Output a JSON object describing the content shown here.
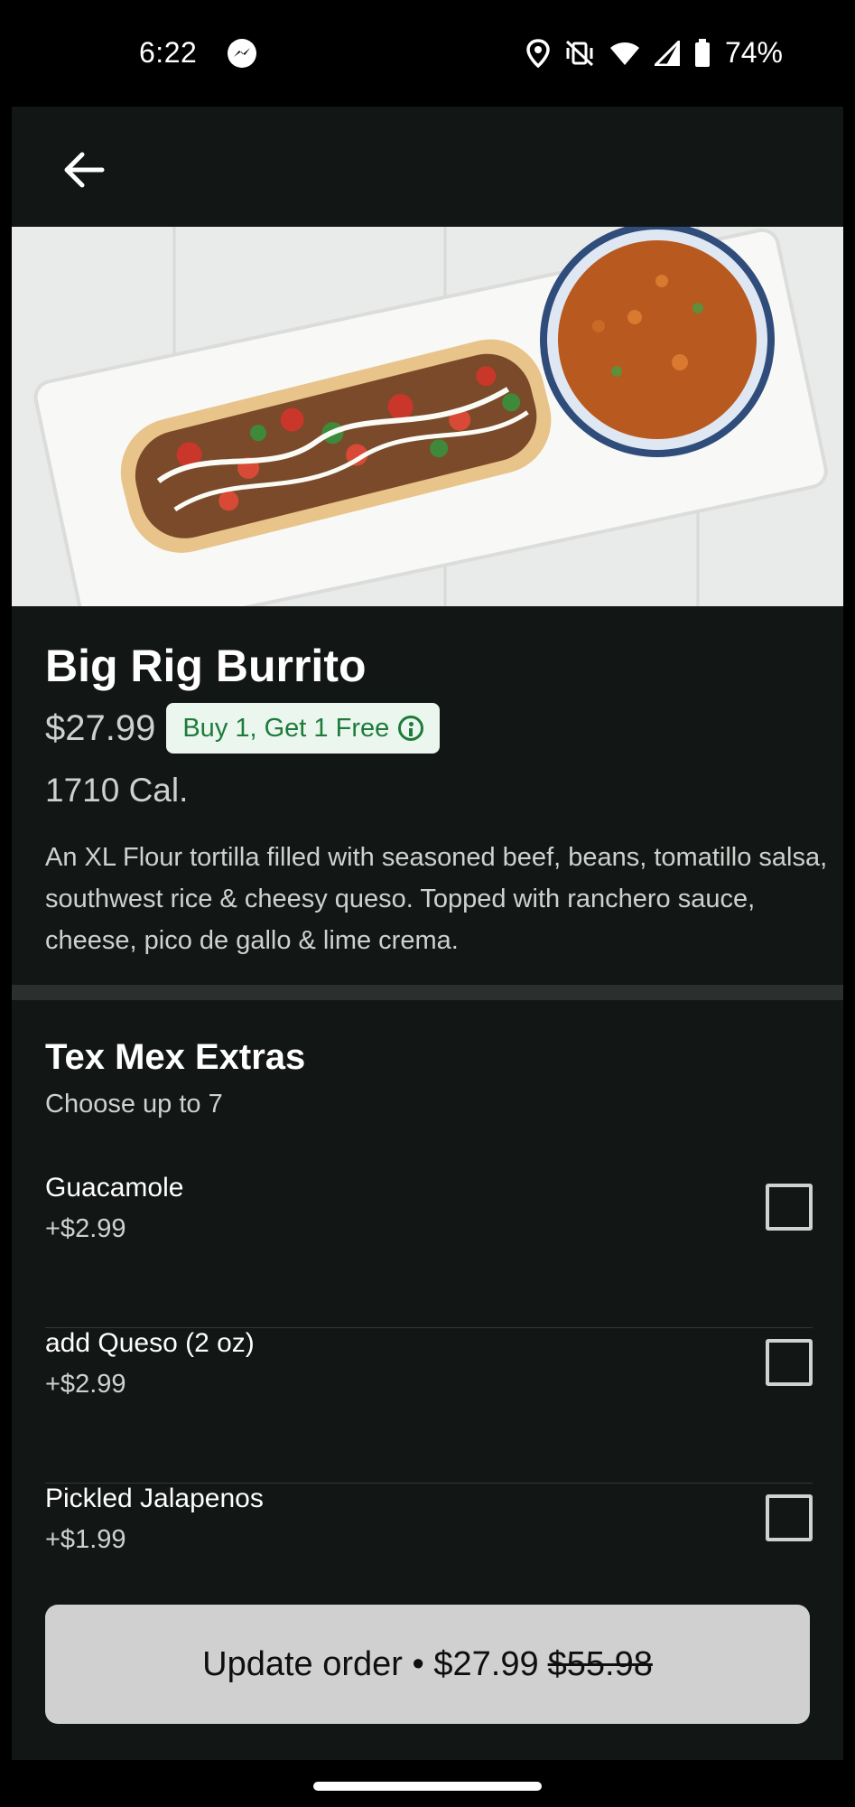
{
  "status_bar": {
    "time": "6:22",
    "battery": "74%",
    "icons": [
      "messenger-icon",
      "location-icon",
      "vibrate-off-icon",
      "wifi-icon",
      "signal-icon",
      "battery-icon"
    ]
  },
  "item": {
    "title": "Big Rig Burrito",
    "price": "$27.99",
    "promo": "Buy 1, Get 1 Free",
    "calories": "1710 Cal.",
    "description": "An XL Flour tortilla filled with seasoned beef, beans, tomatillo salsa, southwest rice & cheesy queso. Topped with ranchero sauce, cheese, pico de gallo & lime crema."
  },
  "section": {
    "title": "Tex Mex Extras",
    "subtitle": "Choose up to 7",
    "options": [
      {
        "name": "Guacamole",
        "price": "+$2.99",
        "checked": false
      },
      {
        "name": "add Queso (2 oz)",
        "price": "+$2.99",
        "checked": false
      },
      {
        "name": "Pickled Jalapenos",
        "price": "+$1.99",
        "checked": false
      }
    ]
  },
  "footer": {
    "button_label": "Update order • $27.99",
    "original_price": "$55.98"
  },
  "colors": {
    "background": "#121614",
    "promo_green": "#1e7b3a",
    "promo_bg": "#eaf6ee",
    "button_bg": "#cfd0cf"
  }
}
